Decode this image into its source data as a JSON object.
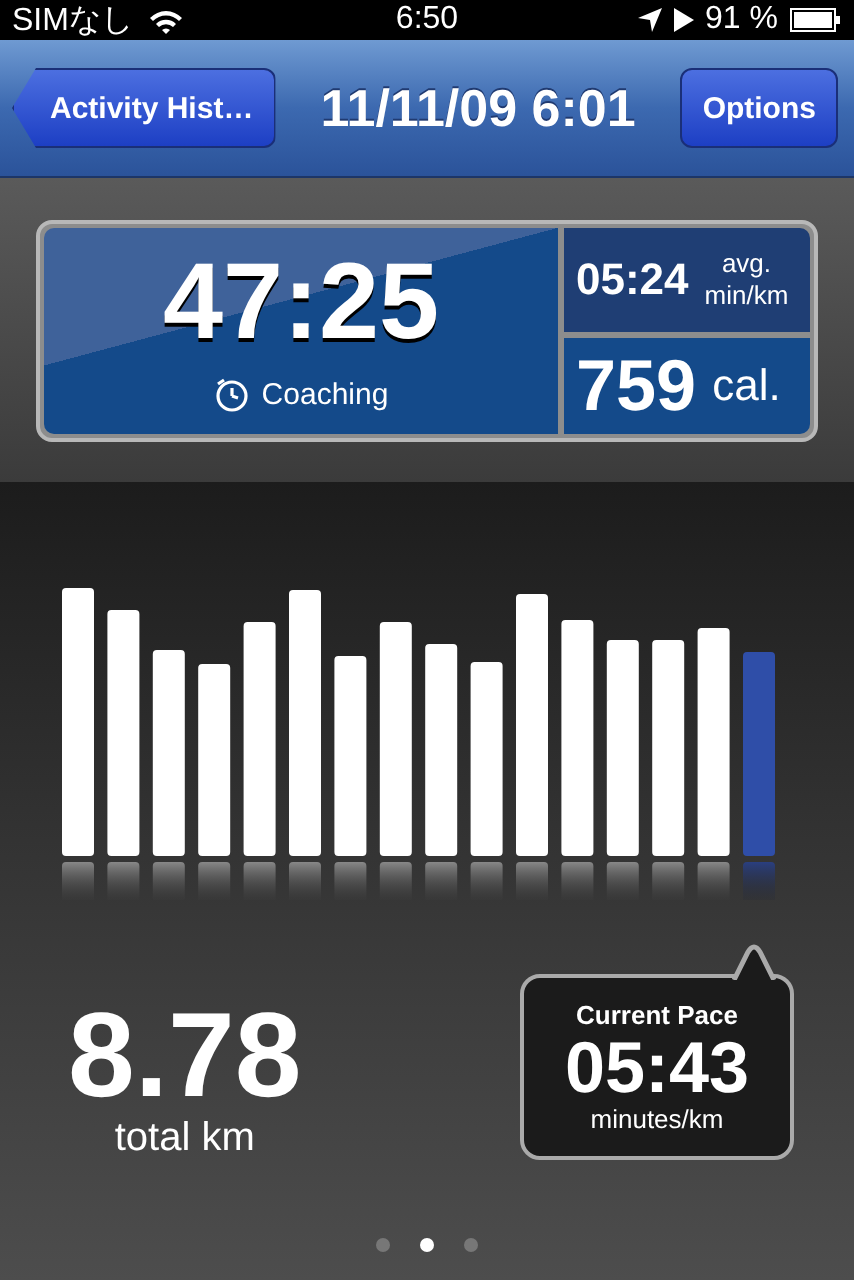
{
  "status_bar": {
    "carrier": "SIMなし",
    "time": "6:50",
    "battery": "91 %"
  },
  "nav_bar": {
    "back_button": "Activity Hist…",
    "title": "11/11/09 6:01",
    "right_button": "Options"
  },
  "summary": {
    "duration": "47:25",
    "coaching": "Coaching",
    "avg_pace": "05:24",
    "avg_label": "avg.",
    "avg_unit": "min/km",
    "calories": "759",
    "calories_unit": "cal."
  },
  "distance": {
    "value": "8.78",
    "label": "total km"
  },
  "current_pace": {
    "title": "Current Pace",
    "value": "05:43",
    "unit": "minutes/km"
  },
  "pages": [
    {
      "selected": false
    },
    {
      "selected": true
    },
    {
      "selected": false
    }
  ]
}
